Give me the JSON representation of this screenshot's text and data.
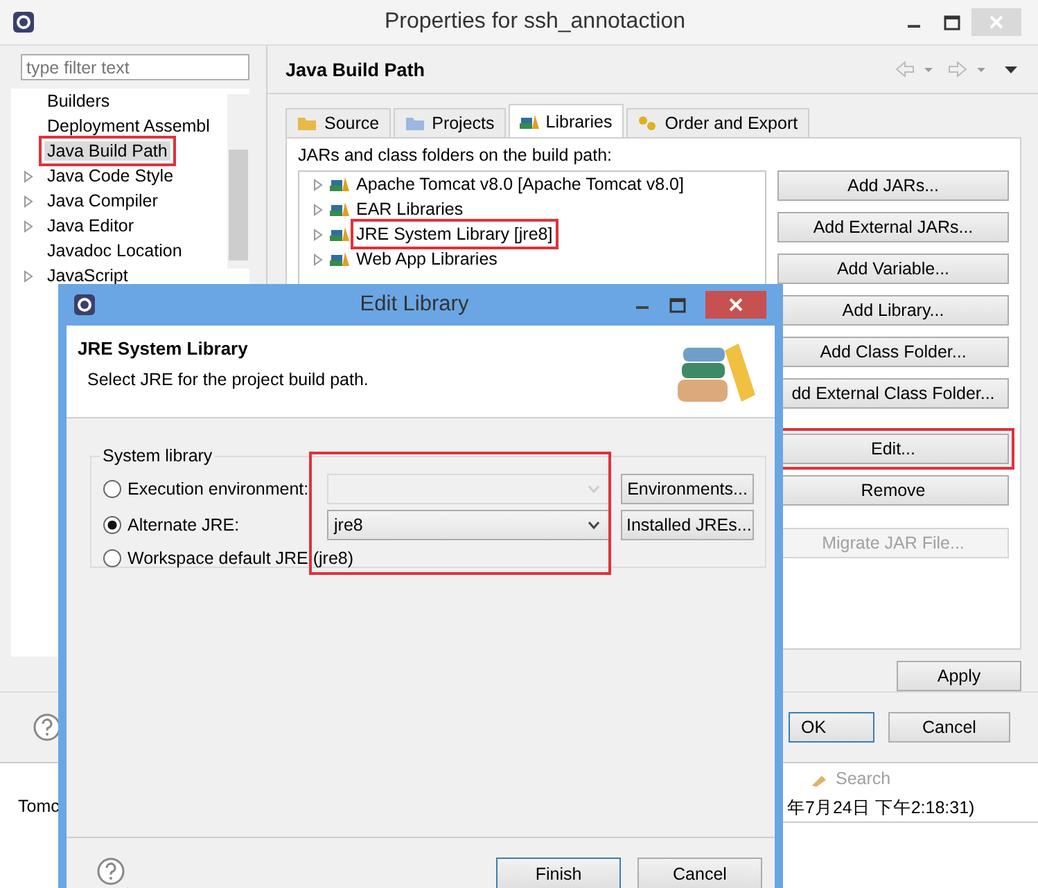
{
  "window": {
    "title": "Properties for ssh_annotaction"
  },
  "filter": {
    "placeholder": "type filter text"
  },
  "sidebar": {
    "items": [
      {
        "label": "Builders",
        "expandable": false,
        "selected": false,
        "highlighted": false
      },
      {
        "label": "Deployment Assembl",
        "expandable": false,
        "selected": false,
        "highlighted": false
      },
      {
        "label": "Java Build Path",
        "expandable": false,
        "selected": true,
        "highlighted": true
      },
      {
        "label": "Java Code Style",
        "expandable": true,
        "selected": false,
        "highlighted": false
      },
      {
        "label": "Java Compiler",
        "expandable": true,
        "selected": false,
        "highlighted": false
      },
      {
        "label": "Java Editor",
        "expandable": true,
        "selected": false,
        "highlighted": false
      },
      {
        "label": "Javadoc Location",
        "expandable": false,
        "selected": false,
        "highlighted": false
      },
      {
        "label": "JavaScript",
        "expandable": true,
        "selected": false,
        "highlighted": false
      }
    ]
  },
  "page": {
    "title": "Java Build Path"
  },
  "tabs": [
    {
      "label": "Source",
      "selected": false
    },
    {
      "label": "Projects",
      "selected": false
    },
    {
      "label": "Libraries",
      "selected": true
    },
    {
      "label": "Order and Export",
      "selected": false
    }
  ],
  "libraries": {
    "caption": "JARs and class folders on the build path:",
    "items": [
      {
        "label": "Apache Tomcat v8.0 [Apache Tomcat v8.0]",
        "highlighted": false
      },
      {
        "label": "EAR Libraries",
        "highlighted": false
      },
      {
        "label": "JRE System Library [jre8]",
        "highlighted": true
      },
      {
        "label": "Web App Libraries",
        "highlighted": false
      }
    ]
  },
  "side_buttons": [
    {
      "label": "Add JARs...",
      "disabled": false,
      "highlighted": false
    },
    {
      "label": "Add External JARs...",
      "disabled": false,
      "highlighted": false
    },
    {
      "label": "Add Variable...",
      "disabled": false,
      "highlighted": false
    },
    {
      "label": "Add Library...",
      "disabled": false,
      "highlighted": false
    },
    {
      "label": "Add Class Folder...",
      "disabled": false,
      "highlighted": false
    },
    {
      "label": "dd External Class Folder...",
      "disabled": false,
      "highlighted": false
    },
    {
      "label": "Edit...",
      "disabled": false,
      "highlighted": true
    },
    {
      "label": "Remove",
      "disabled": false,
      "highlighted": false
    },
    {
      "label": "Migrate JAR File...",
      "disabled": true,
      "highlighted": false
    }
  ],
  "apply": "Apply",
  "footer_buttons": [
    "OK",
    "Cancel"
  ],
  "console": {
    "header": "Tomc",
    "tab": "Search",
    "text": "年7月24日 下午2:18:31)"
  },
  "dialog": {
    "title": "Edit Library",
    "heading": "JRE System Library",
    "description": "Select JRE for the project build path.",
    "group": "System library",
    "highlighted": true,
    "options": [
      {
        "kind": "combo",
        "label": "Execution environment:",
        "selected": false,
        "disabled": true,
        "button": "Environments..."
      },
      {
        "kind": "combo",
        "label": "Alternate JRE:",
        "selected": true,
        "disabled": false,
        "value": "jre8",
        "button": "Installed JREs..."
      },
      {
        "kind": "plain",
        "label": "Workspace default JRE (jre8)",
        "selected": false
      }
    ],
    "buttons": [
      "Finish",
      "Cancel"
    ]
  }
}
